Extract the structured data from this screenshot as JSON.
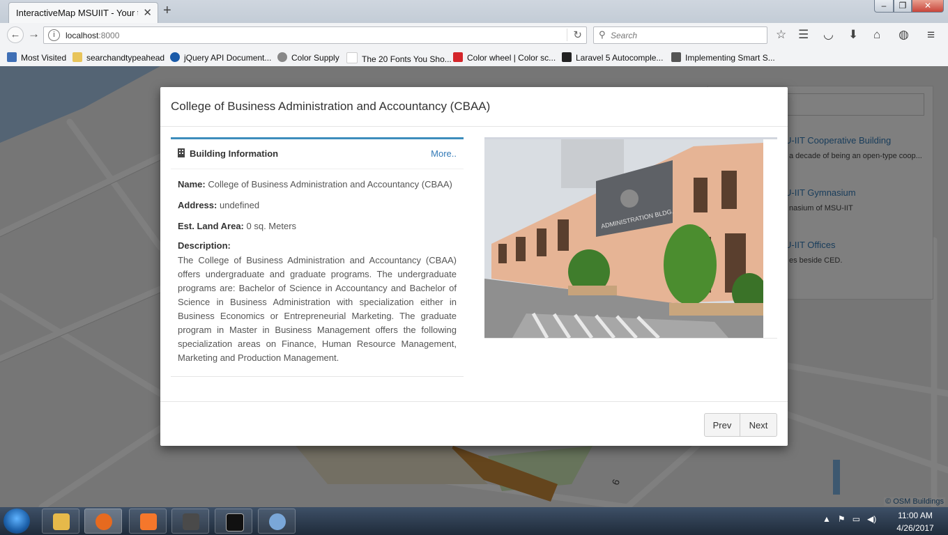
{
  "browser": {
    "tab_title": "InteractiveMap MSUIIT - Your title",
    "url_host": "localhost",
    "url_port": ":8000",
    "search_placeholder": "Search",
    "bookmarks": [
      {
        "label": "Most Visited",
        "icon": "most-visited-icon",
        "color": "#3f6fb5"
      },
      {
        "label": "searchandtypeahead",
        "icon": "folder-icon",
        "color": "#e8c45a"
      },
      {
        "label": "jQuery API Document...",
        "icon": "jquery-icon",
        "color": "#1a5aa8"
      },
      {
        "label": "Color Supply",
        "icon": "color-supply-icon",
        "color": "#888888"
      },
      {
        "label": "The 20 Fonts You Sho...",
        "icon": "page-icon",
        "color": "#dddddd"
      },
      {
        "label": "Color wheel | Color sc...",
        "icon": "adobe-icon",
        "color": "#d4262b"
      },
      {
        "label": "Laravel 5 Autocomple...",
        "icon": "laravel-icon",
        "color": "#222222"
      },
      {
        "label": "Implementing Smart S...",
        "icon": "owl-icon",
        "color": "#555555"
      }
    ]
  },
  "side_list": {
    "items": [
      {
        "title": "U-IIT Cooperative Building",
        "desc": "a decade of being an open-type coop..."
      },
      {
        "title": "U-IIT Gymnasium",
        "desc": "nasium of MSU-IIT"
      },
      {
        "title": "U-IIT Offices",
        "desc": "es beside CED."
      }
    ]
  },
  "map": {
    "attribution": "© OSM Buildings",
    "road_label": "6"
  },
  "modal": {
    "title": "College of Business Administration and Accountancy (CBAA)",
    "panel_title": "Building Information",
    "more_link": "More..",
    "name_label": "Name:",
    "name_value": "College of Business Administration and Accountancy (CBAA)",
    "address_label": "Address:",
    "address_value": "undefined",
    "area_label": "Est. Land Area:",
    "area_value": "0 sq. Meters",
    "description_label": "Description:",
    "description": "The College of Business Administration and Accountancy (CBAA) offers undergraduate and graduate programs. The undergraduate programs are: Bachelor of Science in Accountancy and Bachelor of Science in Business Administration with specialization either in Business Economics or Entrepreneurial Marketing. The graduate program in Master in Business Management offers the following specialization areas on Finance, Human Resource Management, Marketing and Production Management.",
    "photo_sign": "ADMINISTRATION BLDG.",
    "prev_label": "Prev",
    "next_label": "Next"
  },
  "taskbar": {
    "time": "11:00 AM",
    "date": "4/26/2017",
    "apps": [
      {
        "name": "file-explorer-icon",
        "color": "#e6b94a"
      },
      {
        "name": "firefox-icon",
        "color": "#e66a1f"
      },
      {
        "name": "xampp-icon",
        "color": "#f5772b"
      },
      {
        "name": "sublime-text-icon",
        "color": "#4a4a4a"
      },
      {
        "name": "command-prompt-icon",
        "color": "#111111"
      },
      {
        "name": "paint-icon",
        "color": "#7aa7d8"
      }
    ]
  }
}
